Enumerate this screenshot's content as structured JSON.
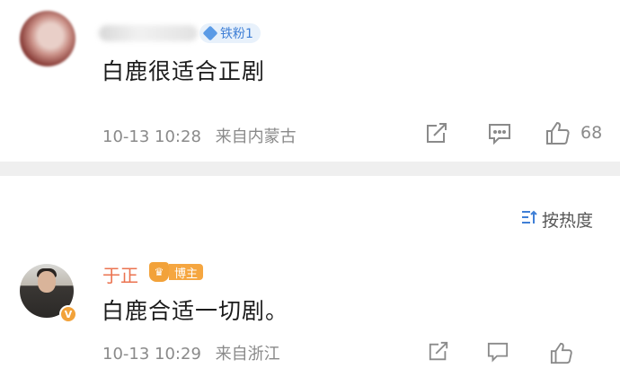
{
  "comments": [
    {
      "fan_badge": "铁粉1",
      "text": "白鹿很适合正剧",
      "time": "10-13 10:28",
      "location": "来自内蒙古",
      "like_count": "68"
    },
    {
      "username": "于正",
      "role_badge": "博主",
      "verified_badge": "V",
      "text": "白鹿合适一切剧。",
      "time": "10-13 10:29",
      "location": "来自浙江"
    }
  ],
  "sort": {
    "label": "按热度"
  },
  "icons": {
    "share": "share-icon",
    "comment": "comment-icon",
    "like": "thumbs-up-icon",
    "sort": "sort-icon",
    "fan": "diamond-icon",
    "crown": "crown-icon"
  },
  "colors": {
    "username": "#eb7350",
    "fan_badge_bg": "#e8f1fb",
    "fan_badge_text": "#3f7fd6",
    "host_badge": "#f5a640",
    "meta_text": "#8a8a8a",
    "divider": "#efefef"
  }
}
